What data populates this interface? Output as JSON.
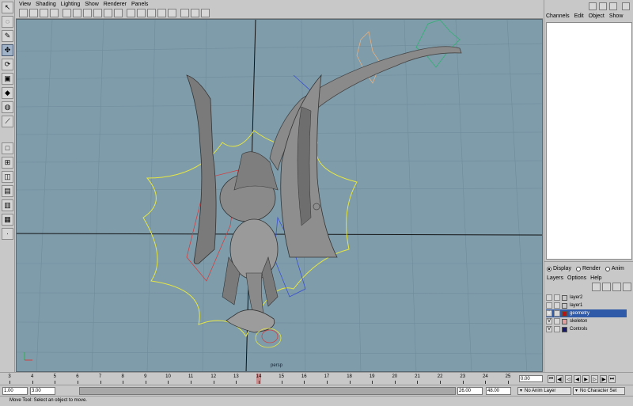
{
  "viewport": {
    "menu": [
      "View",
      "Shading",
      "Lighting",
      "Show",
      "Renderer",
      "Panels"
    ],
    "camera_label": "persp",
    "background_color": "#7f9cab"
  },
  "toolbox": {
    "tools": [
      {
        "icon": "select-arrow-icon",
        "active": false
      },
      {
        "icon": "lasso-icon",
        "active": false
      },
      {
        "icon": "paint-select-icon",
        "active": false
      },
      {
        "icon": "move-tool-icon",
        "active": true
      },
      {
        "icon": "rotate-tool-icon",
        "active": false
      },
      {
        "icon": "scale-tool-icon",
        "active": false
      },
      {
        "icon": "manipulator-icon",
        "active": false
      },
      {
        "icon": "soft-mod-icon",
        "active": false
      },
      {
        "icon": "show-manip-icon",
        "active": false
      }
    ]
  },
  "channel_box": {
    "menu": [
      "Channels",
      "Edit",
      "Object",
      "Show"
    ]
  },
  "layer_editor": {
    "modes": [
      {
        "label": "Display",
        "selected": true
      },
      {
        "label": "Render",
        "selected": false
      },
      {
        "label": "Anim",
        "selected": false
      }
    ],
    "menu": [
      "Layers",
      "Options",
      "Help"
    ],
    "layers": [
      {
        "name": "layer2",
        "visible": "",
        "color": "#c8c8c8",
        "selected": false
      },
      {
        "name": "layer1",
        "visible": "",
        "color": "#c8c8c8",
        "selected": false
      },
      {
        "name": "geometry",
        "visible": "V",
        "color": "#b81414",
        "selected": true
      },
      {
        "name": "skeleton",
        "visible": "V",
        "color": "#e0a0a0",
        "selected": false
      },
      {
        "name": "Controls",
        "visible": "V",
        "color": "#1a1a6a",
        "selected": false
      }
    ]
  },
  "timeline": {
    "ticks": [
      3,
      4,
      5,
      6,
      7,
      8,
      9,
      10,
      11,
      12,
      13,
      14,
      15,
      16,
      17,
      18,
      19,
      20,
      21,
      22,
      23,
      24,
      25
    ],
    "current_frame": 14,
    "current_frame_field": "0.00"
  },
  "range": {
    "start": "1.00",
    "playback_start": "3.00",
    "playback_end": "26.00",
    "end": "48.00",
    "anim_layer": "No Anim Layer",
    "character_set": "No Character Set"
  },
  "help_line": "Move Tool: Select an object to move."
}
